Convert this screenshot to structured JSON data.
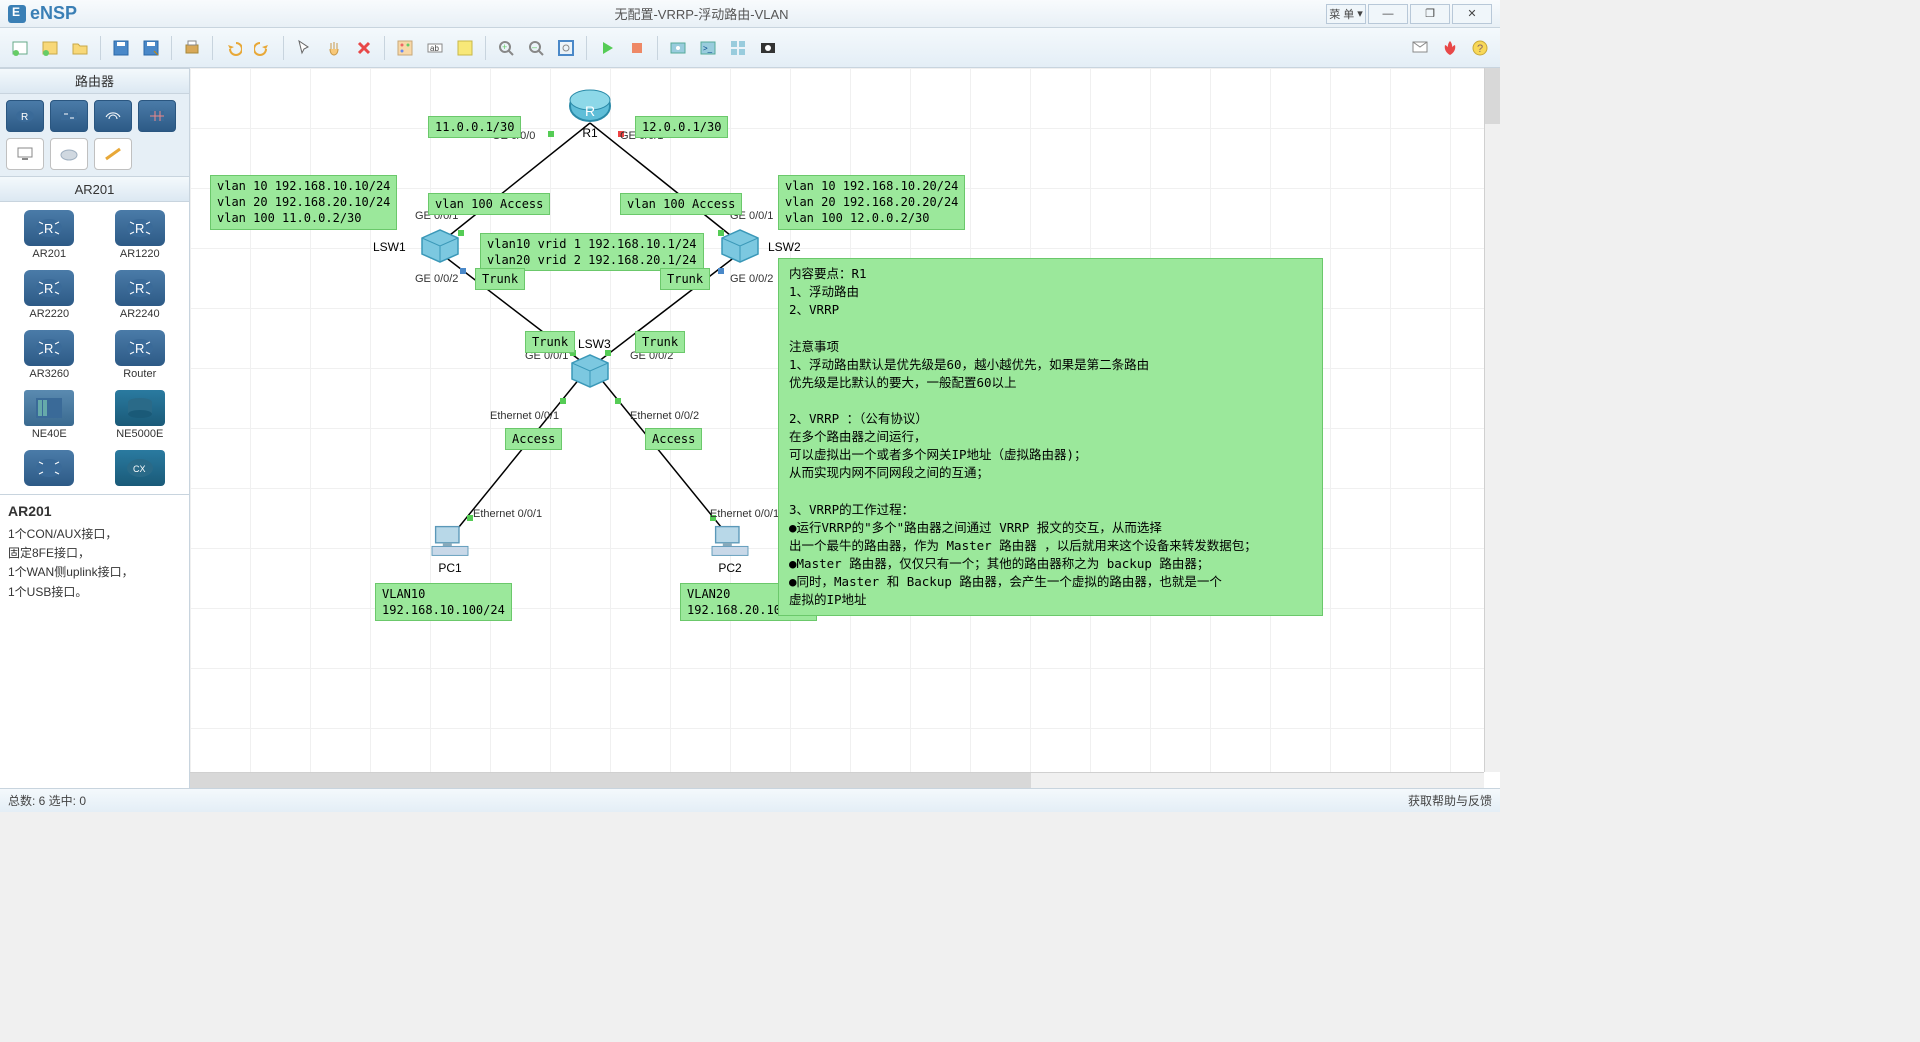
{
  "app": {
    "name": "eNSP",
    "title": "无配置-VRRP-浮动路由-VLAN"
  },
  "winbtns": {
    "menu": "菜 单",
    "min": "—",
    "max": "❐",
    "close": "✕"
  },
  "sidebar": {
    "header1": "路由器",
    "header2": "AR201",
    "devices": [
      {
        "label": "AR201"
      },
      {
        "label": "AR1220"
      },
      {
        "label": "AR2220"
      },
      {
        "label": "AR2240"
      },
      {
        "label": "AR3260"
      },
      {
        "label": "Router"
      },
      {
        "label": "NE40E"
      },
      {
        "label": "NE5000E"
      }
    ],
    "detail": {
      "title": "AR201",
      "lines": [
        "1个CON/AUX接口，",
        "固定8FE接口，",
        "1个WAN侧uplink接口，",
        "1个USB接口。"
      ]
    }
  },
  "topology": {
    "nodes": {
      "R1": {
        "label": "R1"
      },
      "LSW1": {
        "label": "LSW1"
      },
      "LSW2": {
        "label": "LSW2"
      },
      "LSW3": {
        "label": "LSW3"
      },
      "PC1": {
        "label": "PC1"
      },
      "PC2": {
        "label": "PC2"
      }
    },
    "ports": {
      "r1_g000": "GE 0/0/0",
      "r1_g001": "GE 0/0/1",
      "lsw1_g001": "GE 0/0/1",
      "lsw1_g002": "GE 0/0/2",
      "lsw2_g001": "GE 0/0/1",
      "lsw2_g002": "GE 0/0/2",
      "lsw3_g001": "GE 0/0/1",
      "lsw3_g002": "GE 0/0/2",
      "lsw3_e001": "Ethernet 0/0/1",
      "lsw3_e002": "Ethernet 0/0/2",
      "pc1_e001": "Ethernet 0/0/1",
      "pc2_e001": "Ethernet 0/0/1"
    },
    "tags": {
      "ip_r1_left": "11.0.0.1/30",
      "ip_r1_right": "12.0.0.1/30",
      "vlan100_left": "vlan 100 Access",
      "vlan100_right": "vlan 100 Access",
      "lsw1_vlans": "vlan 10 192.168.10.10/24\nvlan 20 192.168.20.10/24\nvlan 100 11.0.0.2/30",
      "lsw2_vlans": "vlan 10 192.168.10.20/24\nvlan 20 192.168.20.20/24\nvlan 100 12.0.0.2/30",
      "vrrp": "vlan10 vrid 1 192.168.10.1/24\nvlan20 vrid 2 192.168.20.1/24",
      "trunk1": "Trunk",
      "trunk2": "Trunk",
      "trunk3": "Trunk",
      "trunk4": "Trunk",
      "access1": "Access",
      "access2": "Access",
      "pc1": "VLAN10\n192.168.10.100/24",
      "pc2": "VLAN20\n192.168.20.100/24"
    },
    "note": "内容要点：R1\n1、浮动路由\n2、VRRP\n\n注意事项\n1、浮动路由默认是优先级是60，越小越优先，如果是第二条路由\n优先级是比默认的要大，一般配置60以上\n\n2、VRRP ：（公有协议）\n在多个路由器之间运行，\n可以虚拟出一个或者多个网关IP地址（虚拟路由器)；\n从而实现内网不同网段之间的互通；\n\n3、VRRP的工作过程：\n●运行VRRP的\"多个\"路由器之间通过 VRRP 报文的交互，从而选择\n出一个最牛的路由器，作为 Master 路由器 ，以后就用来这个设备来转发数据包；\n●Master 路由器，仅仅只有一个；其他的路由器称之为 backup 路由器；\n●同时，Master 和 Backup 路由器，会产生一个虚拟的路由器，也就是一个\n虚拟的IP地址"
  },
  "status": {
    "left": "总数: 6 选中: 0",
    "right": "获取帮助与反馈"
  }
}
